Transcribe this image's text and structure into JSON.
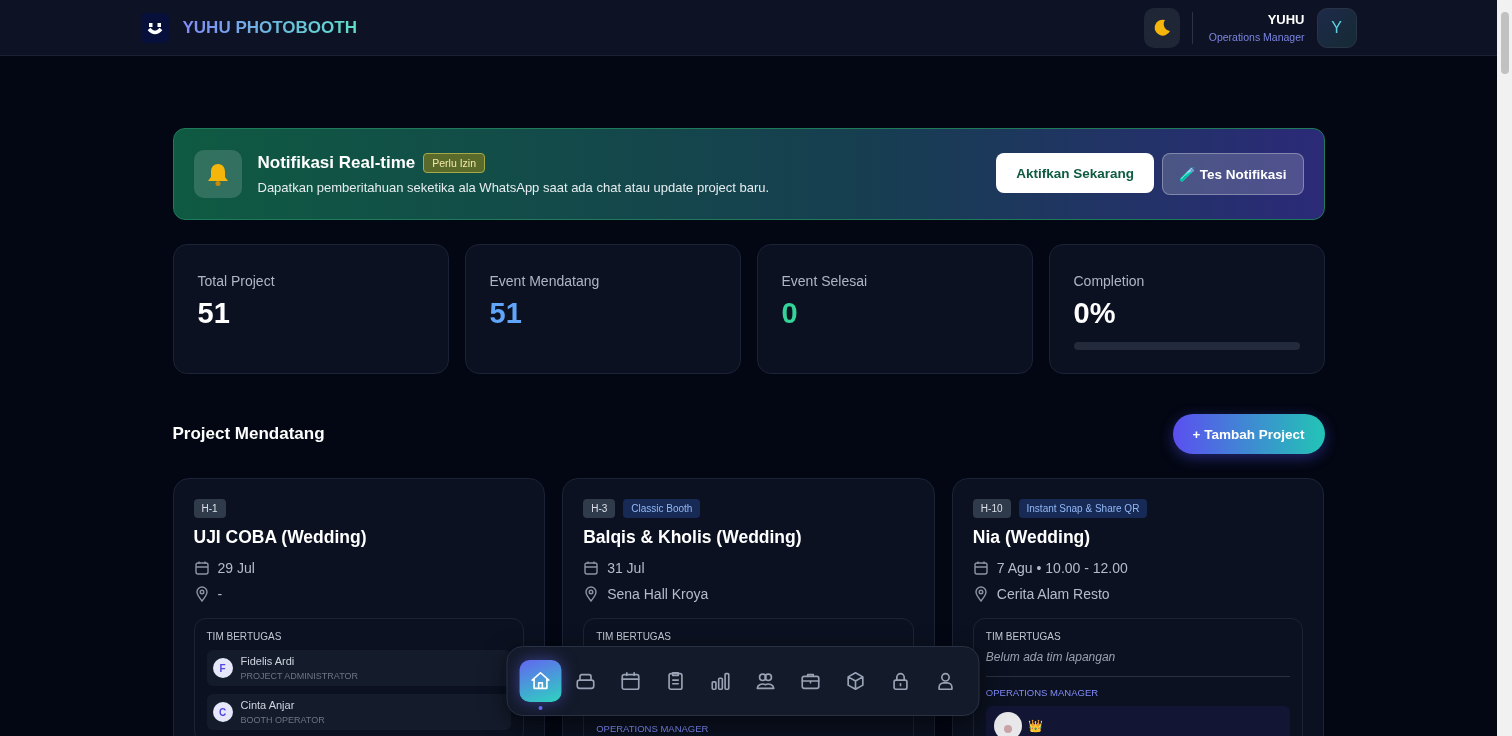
{
  "header": {
    "brand": "YUHU PHOTOBOOTH",
    "user_name": "YUHU",
    "user_role": "Operations Manager",
    "avatar_initial": "Y"
  },
  "notification": {
    "title": "Notifikasi Real-time",
    "badge": "Perlu Izin",
    "message": "Dapatkan pemberitahuan seketika ala WhatsApp saat ada chat atau update project baru.",
    "primary_button": "Aktifkan Sekarang",
    "secondary_button": "🧪 Tes Notifikasi"
  },
  "stats": [
    {
      "label": "Total Project",
      "value": "51",
      "color": "#ffffff"
    },
    {
      "label": "Event Mendatang",
      "value": "51",
      "color": "#60a5fa"
    },
    {
      "label": "Event Selesai",
      "value": "0",
      "color": "#34d399"
    },
    {
      "label": "Completion",
      "value": "0%",
      "color": "#ffffff",
      "level": 0
    }
  ],
  "section": {
    "title": "Project Mendatang",
    "add_button": "+ Tambah Project"
  },
  "projects": [
    {
      "countdown": "H-1",
      "title": "UJI COBA (Wedding)",
      "date": "29 Jul",
      "location": "-",
      "team_label": "TIM BERTUGAS",
      "members": [
        {
          "initial": "F",
          "name": "Fidelis Ardi",
          "role": "PROJECT ADMINISTRATOR"
        },
        {
          "initial": "C",
          "name": "Cinta Anjar",
          "role": "BOOTH OPERATOR"
        }
      ]
    },
    {
      "countdown": "H-3",
      "package": "Classic Booth",
      "title": "Balqis & Kholis (Wedding)",
      "date": "31 Jul",
      "location": "Sena Hall Kroya",
      "team_label": "TIM BERTUGAS",
      "manager_label": "OPERATIONS MANAGER"
    },
    {
      "countdown": "H-10",
      "package": "Instant Snap & Share QR",
      "title": "Nia (Wedding)",
      "date": "7 Agu • 10.00 - 12.00",
      "location": "Cerita Alam Resto",
      "team_label": "TIM BERTUGAS",
      "empty_note": "Belum ada tim lapangan",
      "manager_label": "OPERATIONS MANAGER",
      "managers": [
        {
          "mark": "👑"
        }
      ]
    }
  ],
  "dock": [
    {
      "kind": "home",
      "selected": true
    },
    {
      "kind": "inbox",
      "selected": false
    },
    {
      "kind": "calendar",
      "selected": false
    },
    {
      "kind": "clipboard",
      "selected": false
    },
    {
      "kind": "chart",
      "selected": false
    },
    {
      "kind": "users",
      "selected": false
    },
    {
      "kind": "briefcase",
      "selected": false
    },
    {
      "kind": "box",
      "selected": false
    },
    {
      "kind": "lock",
      "selected": false
    },
    {
      "kind": "user",
      "selected": false
    }
  ]
}
